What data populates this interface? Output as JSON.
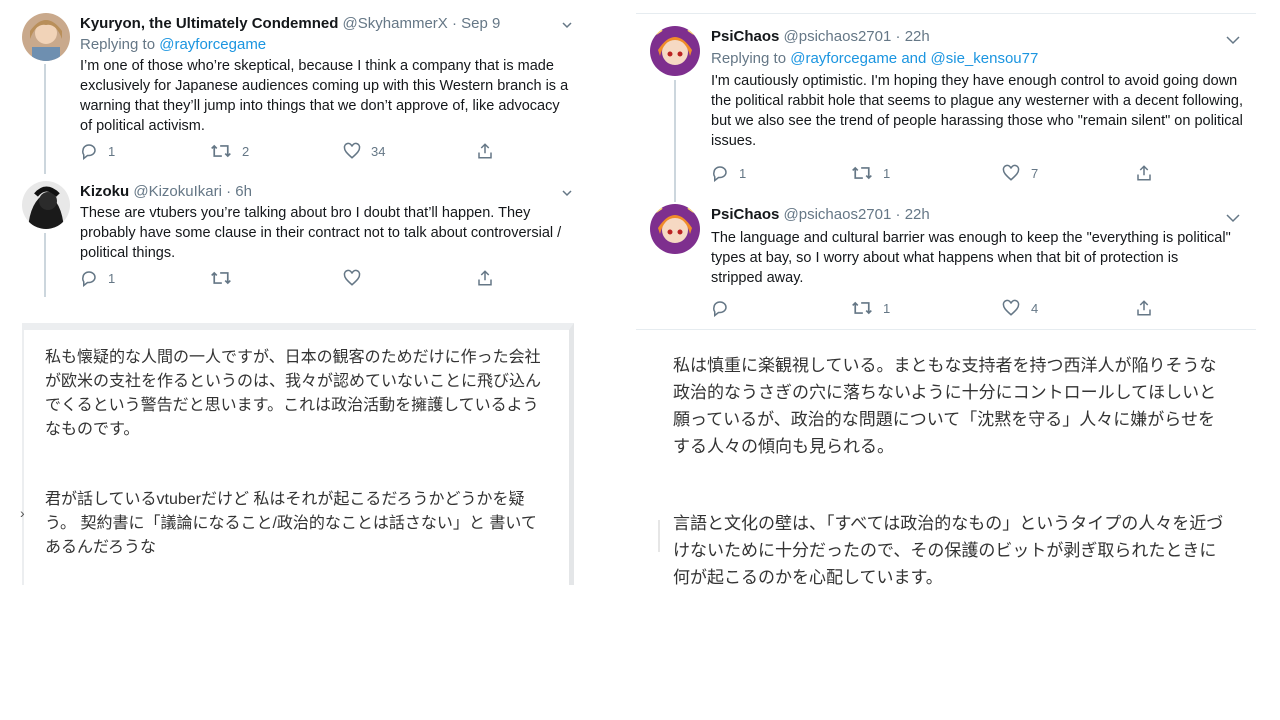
{
  "left": {
    "tweets": [
      {
        "name": "Kyuryon, the Ultimately Condemned",
        "handle": "@SkyhammerX",
        "sep": "·",
        "time": "Sep 9",
        "replying_prefix": "Replying to",
        "replying_to": "@rayforcegame",
        "text": "I’m one of those who’re skeptical, because I think a company that is made exclusively for Japanese audiences coming up with this Western branch is a warning that they’ll jump into things that we don’t approve of, like advocacy of political activism.",
        "replies": "1",
        "retweets": "2",
        "likes": "34",
        "avatar_icon": "user-avatar-icon"
      },
      {
        "name": "Kizoku",
        "handle": "@KizokuIkari",
        "sep": "·",
        "time": "6h",
        "text": "These are vtubers you’re talking about bro I doubt that’ll happen. They probably have some clause in their contract not to talk about controversial / political things.",
        "replies": "1",
        "retweets": "",
        "likes": "",
        "avatar_icon": "user-avatar-icon"
      }
    ],
    "translation": {
      "p1": "私も懐疑的な人間の一人ですが、日本の観客のためだけに作った会社が欧米の支社を作るというのは、我々が認めていないことに飛び込んでくるという警告だと思います。これは政治活動を擁護しているようなものです。",
      "p2": "君が話しているvtuberだけど 私はそれが起こるだろうかどうかを疑う。 契約書に「議論になること/政治的なことは話さない」と 書いてあるんだろうな"
    }
  },
  "right": {
    "tweets": [
      {
        "name": "PsiChaos",
        "handle": "@psichaos2701",
        "sep": "·",
        "time": "22h",
        "replying_prefix": "Replying to",
        "replying_to": "@rayforcegame and @sie_kensou77",
        "text": "I'm cautiously optimistic. I'm hoping they have enough control to avoid going down the political rabbit hole that seems to plague any westerner with a decent following, but we also see the trend of people harassing those who \"remain silent\" on political issues.",
        "replies": "1",
        "retweets": "1",
        "likes": "7",
        "avatar_icon": "user-avatar-icon"
      },
      {
        "name": "PsiChaos",
        "handle": "@psichaos2701",
        "sep": "·",
        "time": "22h",
        "text": "The language and cultural barrier was enough to keep the \"everything is political\" types at bay, so I worry about what happens when that bit of protection is stripped away.",
        "replies": "",
        "retweets": "1",
        "likes": "4",
        "avatar_icon": "user-avatar-icon"
      }
    ],
    "translation": {
      "p1": "私は慎重に楽観視している。まともな支持者を持つ西洋人が陥りそうな政治的なうさぎの穴に落ちないように十分にコントロールしてほしいと願っているが、政治的な問題について「沈黙を守る」人々に嫌がらせをする人々の傾向も見られる。",
      "p2": "言語と文化の壁は、「すべては政治的なもの」というタイプの人々を近づけないために十分だったので、その保護のビットが剥ぎ取られたときに何が起こるのかを心配しています。"
    }
  },
  "colors": {
    "link": "#1b95e0",
    "muted": "#657786",
    "border": "#e6ecf0",
    "thread": "#ccd6dd"
  },
  "icons": [
    "reply-icon",
    "retweet-icon",
    "like-icon",
    "share-icon",
    "chevron-down-icon"
  ]
}
